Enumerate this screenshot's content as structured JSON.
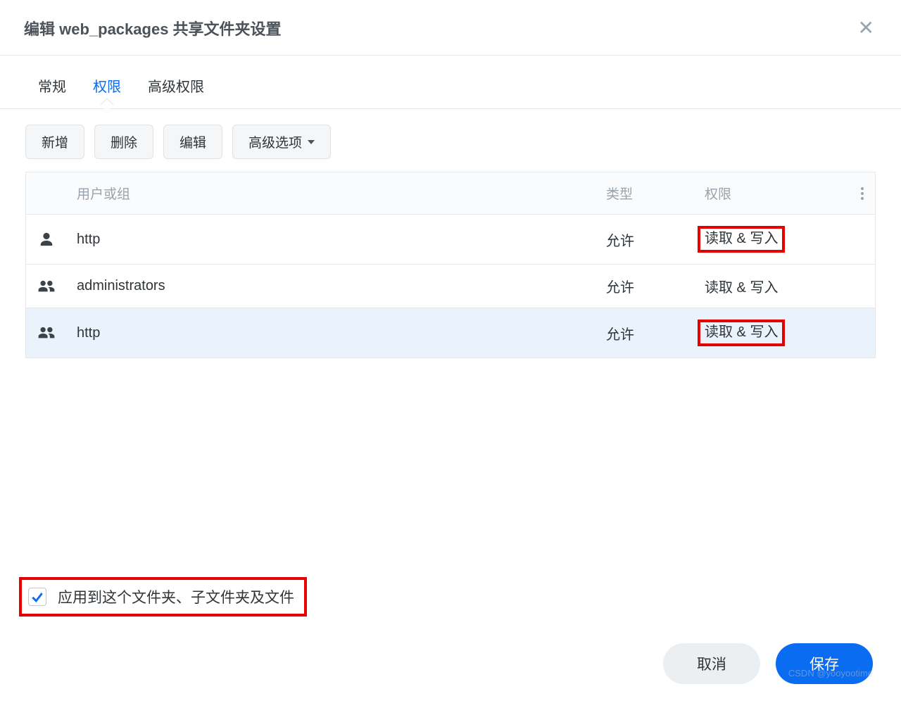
{
  "header": {
    "title": "编辑 web_packages 共享文件夹设置"
  },
  "tabs": [
    {
      "label": "常规",
      "active": false
    },
    {
      "label": "权限",
      "active": true
    },
    {
      "label": "高级权限",
      "active": false
    }
  ],
  "toolbar": {
    "add": "新增",
    "delete": "删除",
    "edit": "编辑",
    "advanced": "高级选项"
  },
  "table": {
    "columns": {
      "user": "用户或组",
      "type": "类型",
      "permission": "权限"
    },
    "rows": [
      {
        "icon": "user",
        "name": "http",
        "type": "允许",
        "permission": "读取 & 写入",
        "highlight": true,
        "selected": false
      },
      {
        "icon": "group",
        "name": "administrators",
        "type": "允许",
        "permission": "读取 & 写入",
        "highlight": false,
        "selected": false
      },
      {
        "icon": "group",
        "name": "http",
        "type": "允许",
        "permission": "读取 & 写入",
        "highlight": true,
        "selected": true
      }
    ]
  },
  "checkbox": {
    "label": "应用到这个文件夹、子文件夹及文件",
    "checked": true
  },
  "footer": {
    "cancel": "取消",
    "save": "保存"
  },
  "watermark": "CSDN @yooyootime"
}
